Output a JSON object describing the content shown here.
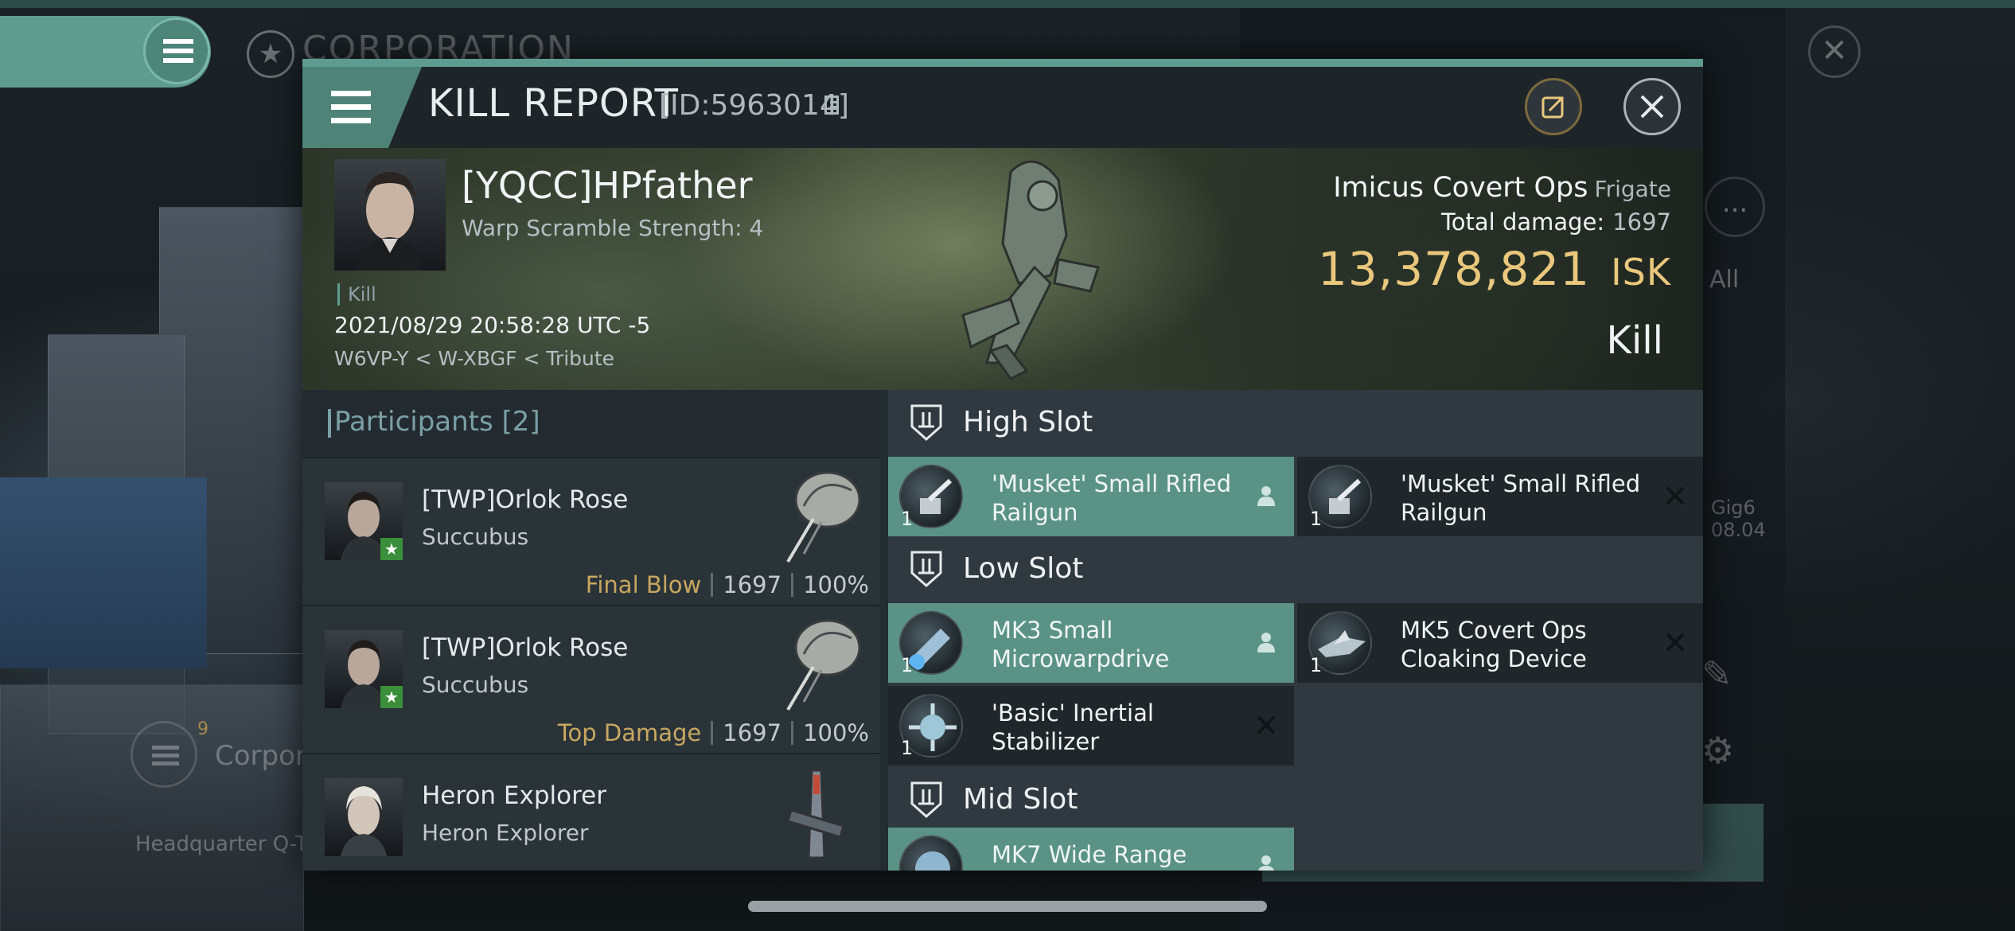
{
  "background": {
    "screen_title": "CORPORATION",
    "more_label": "...",
    "all_label": "All",
    "gig_name": "Gig6",
    "gig_date": "08.04",
    "corp_label": "Corpor",
    "corp_badge": "9",
    "hq_label": "Headquarter Q-T"
  },
  "modal": {
    "title": "KILL REPORT",
    "report_id": "[ID:5963014]",
    "icons": {
      "menu": "menu-icon",
      "copy": "copy-icon",
      "share": "share-icon",
      "close": "close-icon"
    }
  },
  "victim": {
    "name": "[YQCC]HPfather",
    "warp_scramble": "Warp Scramble Strength: 4",
    "kill_tag": "Kill",
    "timestamp": "2021/08/29 20:58:28 UTC -5",
    "location": "W6VP-Y < W-XBGF < Tribute",
    "ship_name": "Imicus Covert Ops",
    "ship_class": "Frigate",
    "total_damage_label": "Total damage:",
    "total_damage_value": "1697",
    "isk_value": "13,378,821",
    "isk_unit": "ISK",
    "result": "Kill"
  },
  "participants": {
    "title": "Participants [2]",
    "rows": [
      {
        "name": "[TWP]Orlok Rose",
        "ship": "Succubus",
        "tag": "Final Blow",
        "damage": "1697",
        "percent": "100%"
      },
      {
        "name": "[TWP]Orlok Rose",
        "ship": "Succubus",
        "tag": "Top Damage",
        "damage": "1697",
        "percent": "100%"
      },
      {
        "name": "Heron Explorer",
        "ship": "Heron Explorer"
      }
    ]
  },
  "fitting": {
    "high_slot": {
      "title": "High Slot",
      "modules": [
        {
          "name": "'Musket' Small Rifled Railgun",
          "qty": "1",
          "status": "fitted"
        },
        {
          "name": "'Musket' Small Rifled Railgun",
          "qty": "1",
          "status": "destroyed"
        }
      ]
    },
    "low_slot": {
      "title": "Low Slot",
      "modules": [
        {
          "name": "MK3 Small Microwarpdrive",
          "qty": "1",
          "status": "fitted"
        },
        {
          "name": "MK5 Covert Ops Cloaking Device",
          "qty": "1",
          "status": "destroyed"
        },
        {
          "name": "'Basic' Inertial Stabilizer",
          "qty": "1",
          "status": "destroyed"
        }
      ]
    },
    "mid_slot": {
      "title": "Mid Slot",
      "modules": [
        {
          "name": "MK7 Wide Range",
          "status": "fitted"
        }
      ]
    }
  },
  "colors": {
    "accent_teal": "#5e9c8f",
    "isk_gold": "#e9c77c",
    "tag_gold": "#c8a761"
  }
}
